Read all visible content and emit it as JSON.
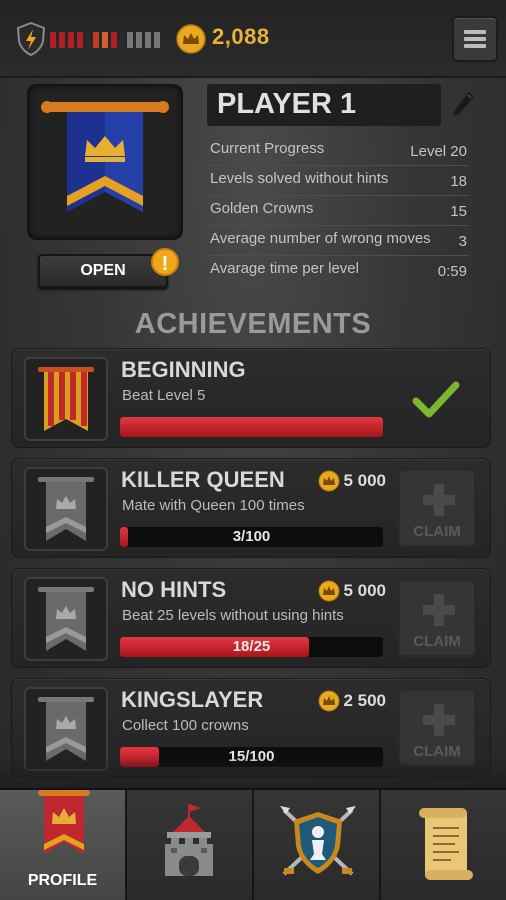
{
  "topbar": {
    "coins": "2,088",
    "energy_icon": "shield-lightning-icon",
    "coin_icon": "crown-coin-icon",
    "menu_icon": "hamburger-menu-icon"
  },
  "profile": {
    "player_name": "PLAYER 1",
    "open_label": "OPEN",
    "alert": "!",
    "stats": [
      {
        "label": "Current Progress",
        "value": "Level 20"
      },
      {
        "label": "Levels solved without hints",
        "value": "18"
      },
      {
        "label": "Golden Crowns",
        "value": "15"
      },
      {
        "label": "Average number of wrong moves",
        "value": "3"
      },
      {
        "label": "Avarage time per level",
        "value": "0:59"
      }
    ]
  },
  "achievements_title": "ACHIEVEMENTS",
  "achievements": [
    {
      "name": "BEGINNING",
      "description": "Beat Level 5",
      "progress_text": "",
      "progress": 1.0,
      "reward": "",
      "claim_label": "",
      "completed": true
    },
    {
      "name": "KILLER QUEEN",
      "description": "Mate with Queen 100 times",
      "progress_text": "3/100",
      "progress": 0.03,
      "reward": "5 000",
      "claim_label": "CLAIM",
      "completed": false
    },
    {
      "name": "NO HINTS",
      "description": "Beat 25 levels without using hints",
      "progress_text": "18/25",
      "progress": 0.72,
      "reward": "5 000",
      "claim_label": "CLAIM",
      "completed": false
    },
    {
      "name": "KINGSLAYER",
      "description": "Collect 100 crowns",
      "progress_text": "15/100",
      "progress": 0.15,
      "reward": "2 500",
      "claim_label": "CLAIM",
      "completed": false
    }
  ],
  "tabs": [
    {
      "label": "PROFILE",
      "icon": "banner-crown-icon",
      "active": true
    },
    {
      "label": "",
      "icon": "castle-tower-icon",
      "active": false
    },
    {
      "label": "",
      "icon": "shield-swords-icon",
      "active": false
    },
    {
      "label": "",
      "icon": "scroll-icon",
      "active": false
    }
  ],
  "colors": {
    "accent_gold": "#e8b23a",
    "progress_red": "#d42a32",
    "check_green": "#7cb82f",
    "banner_blue": "#2540a8"
  }
}
